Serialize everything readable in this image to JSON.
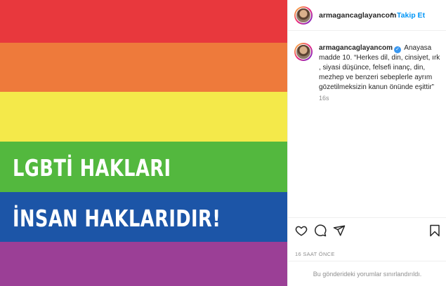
{
  "post": {
    "image": {
      "line1": "LGBTİ HAKLARI",
      "line2": "İNSAN HAKLARIDIR!",
      "stripe_colors": [
        "#e8383d",
        "#ee7a3b",
        "#f4e94a",
        "#53b83e",
        "#1c55a7",
        "#9b3f96"
      ]
    },
    "header": {
      "username": "armagancaglayancom",
      "separator": "•",
      "follow_label": "Takip Et"
    },
    "caption": {
      "username": "armagancaglayancom",
      "text": "Anayasa madde 10. “Herkes dil, din, cinsiyet, ırk , siyasi düşünce, felsefi inanç, din, mezhep ve benzeri sebeplerle ayrım gözetilmeksizin kanun önünde eşittir”",
      "age": "16s"
    },
    "icons": {
      "like": "heart-icon",
      "comment": "comment-icon",
      "share": "share-icon",
      "save": "bookmark-icon"
    },
    "timestamp": "16 SAAT ÖNCE",
    "comments_notice": "Bu gönderideki yorumlar sınırlandırıldı.",
    "colors": {
      "accent": "#0095f6",
      "verified": "#3897f0",
      "muted": "#8e8e8e"
    }
  }
}
